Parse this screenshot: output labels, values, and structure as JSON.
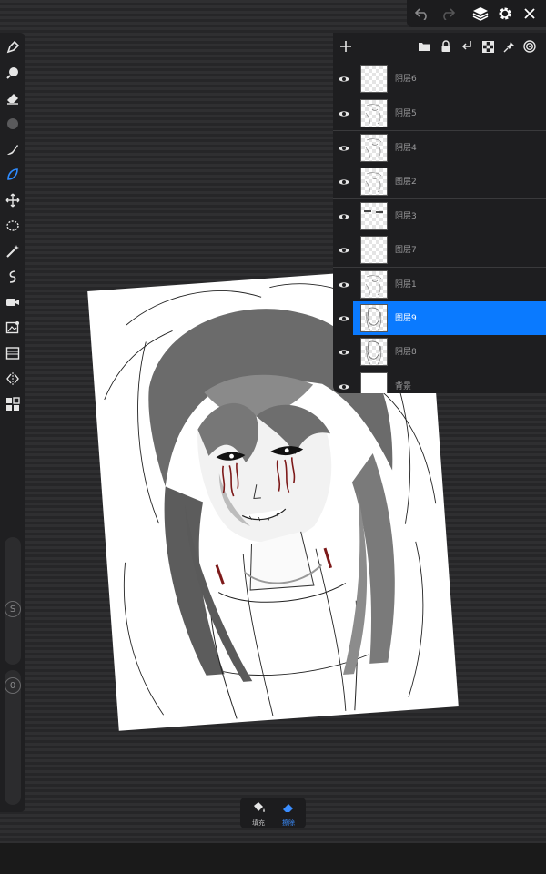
{
  "top_bar": {
    "icons": [
      "undo-icon",
      "redo-icon",
      "layers-icon",
      "settings-icon",
      "close-icon"
    ]
  },
  "left_toolbar": {
    "tools": [
      "pen-icon",
      "brush-icon",
      "eraser-icon",
      "color-dot-icon",
      "smudge-icon",
      "lasso-brush-icon",
      "move-icon",
      "lasso-select-icon",
      "magic-wand-icon",
      "curve-icon",
      "video-icon",
      "image-adjust-icon",
      "filter-icon",
      "symmetry-icon",
      "grid-icon"
    ],
    "size_slider_label": "S",
    "opacity_slider_label": "0"
  },
  "layers_panel": {
    "header_icons": [
      "add-icon",
      "folder-icon",
      "lock-icon",
      "merge-down-icon",
      "checker-icon",
      "pin-icon",
      "target-icon"
    ],
    "layers": [
      {
        "name": "阴层6",
        "thumb": "blank"
      },
      {
        "name": "阴层5",
        "thumb": "sketch"
      },
      {
        "name": "阴层4",
        "thumb": "sketch"
      },
      {
        "name": "图层2",
        "thumb": "sketch"
      },
      {
        "name": "阴层3",
        "thumb": "eyes"
      },
      {
        "name": "图层7",
        "thumb": "blank"
      },
      {
        "name": "阴层1",
        "thumb": "sketch"
      },
      {
        "name": "图层9",
        "thumb": "figure",
        "active": true
      },
      {
        "name": "阴层8",
        "thumb": "figure"
      },
      {
        "name": "背景",
        "thumb": "white"
      }
    ]
  },
  "bottom_tools": {
    "fill_label": "填充",
    "eraser_label": "擦除"
  },
  "colors": {
    "accent": "#0a7aff",
    "panel": "#1e1e20"
  }
}
